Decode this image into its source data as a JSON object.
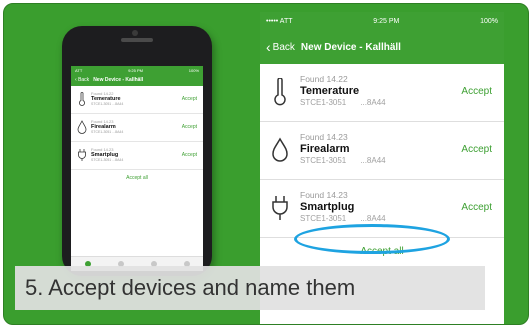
{
  "colors": {
    "accent": "#3ea033",
    "background": "#3a9e2e",
    "highlight_ring": "#1ea3e1"
  },
  "phone": {
    "status": {
      "carrier": "ATT",
      "time": "9:25 PM",
      "battery": "100%"
    },
    "nav": {
      "back": "Back",
      "title": "New Device - Kallhäll"
    },
    "devices": [
      {
        "found": "Found 14.22",
        "name": "Temerature",
        "code": "STCE1-3051",
        "suffix": "...8A44",
        "accept": "Accept",
        "icon": "thermometer-icon"
      },
      {
        "found": "Found 14.23",
        "name": "Firealarm",
        "code": "STCE1-3051",
        "suffix": "...8A44",
        "accept": "Accept",
        "icon": "flame-icon"
      },
      {
        "found": "Found 14.23",
        "name": "Smartplug",
        "code": "STCE1-3051",
        "suffix": "...8A44",
        "accept": "Accept",
        "icon": "plug-icon"
      }
    ],
    "accept_all": "Accept all"
  },
  "zoom": {
    "status": {
      "carrier": "••••• ATT",
      "time": "9:25 PM",
      "battery": "100%"
    },
    "nav": {
      "back": "Back",
      "title": "New Device - Kallhäll"
    },
    "devices": [
      {
        "found": "Found 14.22",
        "name": "Temerature",
        "code": "STCE1-3051",
        "suffix": "...8A44",
        "accept": "Accept",
        "icon": "thermometer-icon"
      },
      {
        "found": "Found 14.23",
        "name": "Firealarm",
        "code": "STCE1-3051",
        "suffix": "...8A44",
        "accept": "Accept",
        "icon": "flame-icon"
      },
      {
        "found": "Found 14.23",
        "name": "Smartplug",
        "code": "STCE1-3051",
        "suffix": "...8A44",
        "accept": "Accept",
        "icon": "plug-icon"
      }
    ],
    "accept_all": "Accept all"
  },
  "caption": "5. Accept devices and name them"
}
